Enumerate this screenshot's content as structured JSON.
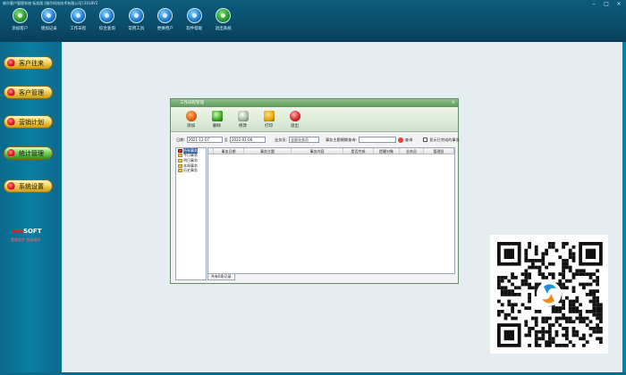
{
  "app": {
    "title": "维尔客户管理系统 标准版 [维尔科技技术有限公司] 2018V2",
    "window_controls": [
      "–",
      "□",
      "×"
    ]
  },
  "toolbar": [
    {
      "label": "添加客户",
      "icon": "add-customer-icon",
      "color": "green"
    },
    {
      "label": "增加记录",
      "icon": "add-record-icon",
      "color": "blue"
    },
    {
      "label": "工作日程",
      "icon": "calendar-icon",
      "color": "blue"
    },
    {
      "label": "综合查询",
      "icon": "query-icon",
      "color": "blue"
    },
    {
      "label": "常用工具",
      "icon": "tools-icon",
      "color": "blue"
    },
    {
      "label": "更换用户",
      "icon": "switch-user-icon",
      "color": "blue"
    },
    {
      "label": "软件帮助",
      "icon": "help-icon",
      "color": "blue"
    },
    {
      "label": "退出系统",
      "icon": "exit-icon",
      "color": "green"
    }
  ],
  "sidebar": {
    "items": [
      {
        "label": "客户往来"
      },
      {
        "label": "客户管理"
      },
      {
        "label": "营销计划"
      },
      {
        "label": "统计管理"
      },
      {
        "label": "系统设置"
      }
    ],
    "logo_prefix": "ww",
    "logo_main": "SOFT",
    "logo_subtitle": "管理软件 首选维尔"
  },
  "dialog": {
    "title": "工作日程管理",
    "close": "×",
    "toolbar": [
      {
        "label": "添加",
        "icon": "add-icon"
      },
      {
        "label": "删除",
        "icon": "delete-icon"
      },
      {
        "label": "修改",
        "icon": "edit-icon"
      },
      {
        "label": "打印",
        "icon": "print-icon"
      },
      {
        "label": "退出",
        "icon": "exit-icon"
      }
    ],
    "filter": {
      "date_label": "日期:",
      "date_from": "2021-12-07",
      "to_label": "至",
      "date_to": "2022-01-06",
      "owner_label": "业务员:",
      "owner_value": "全部业务员",
      "subject_label": "事务主题模糊查询:",
      "subject_value": "",
      "search_label": "查询",
      "show_done_label": "显示已完成的事务"
    },
    "tree": [
      {
        "label": "所有事务",
        "selected": true
      },
      {
        "label": "今日事务"
      },
      {
        "label": "明日事务"
      },
      {
        "label": "本周事务"
      },
      {
        "label": "历史事务"
      }
    ],
    "grid": {
      "columns": [
        "",
        "事务日期",
        "事务主题",
        "事务内容",
        "是否完成",
        "提醒对象",
        "业务员",
        "管理员"
      ],
      "rows": []
    },
    "footer_text": "共有0条记录"
  }
}
